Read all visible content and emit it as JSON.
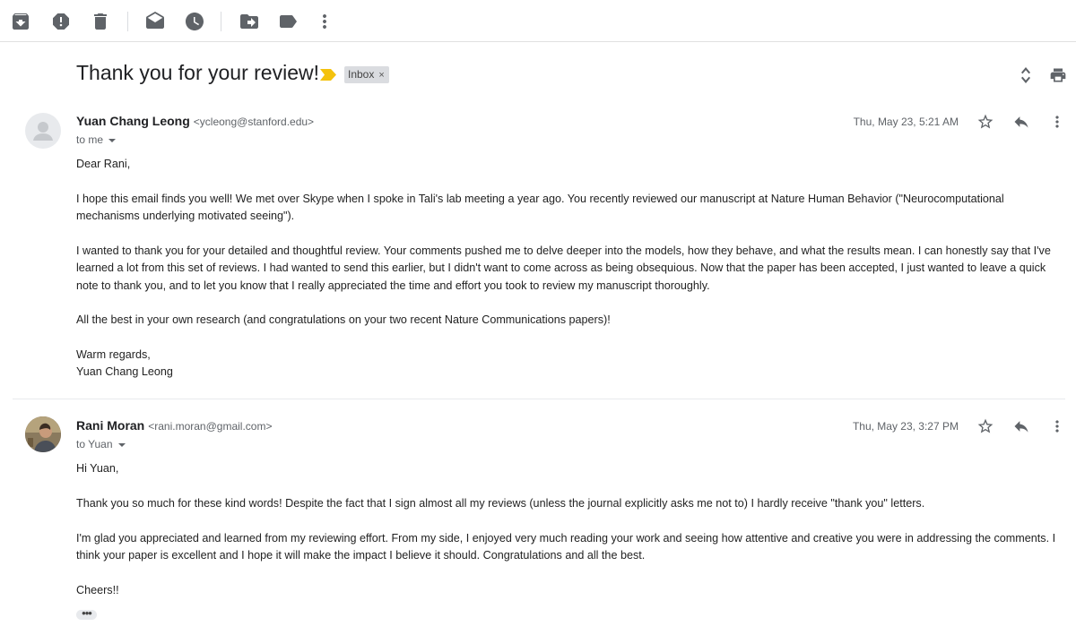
{
  "toolbar": {
    "icons": [
      "archive-icon",
      "report-spam-icon",
      "delete-icon",
      "mark-unread-icon",
      "snooze-icon",
      "move-to-icon",
      "label-icon",
      "more-vert-icon"
    ]
  },
  "thread": {
    "subject": "Thank you for your review!",
    "label": "Inbox",
    "label_close": "×",
    "colors": {
      "importance": "#f4c20d",
      "label_bg": "#dadce0"
    }
  },
  "messages": [
    {
      "sender_name": "Yuan Chang Leong",
      "sender_email": "<ycleong@stanford.edu>",
      "to": "to me",
      "date": "Thu, May 23, 5:21 AM",
      "paragraphs": [
        "Dear Rani,",
        "I hope this email finds you well! We met over Skype when I spoke in Tali's lab meeting a year ago. You recently reviewed our manuscript at Nature Human Behavior (\"Neurocomputational mechanisms underlying motivated seeing\").",
        "I wanted to thank you for your detailed and thoughtful review. Your comments pushed me to delve deeper into the models, how they behave, and what the results mean. I can honestly say that I've learned a lot from this set of reviews. I had wanted to send this earlier, but I didn't want to come across as being obsequious. Now that the paper has been accepted, I just wanted to leave a quick note to thank you, and to let you know that I really appreciated the time and effort you took to review my manuscript thoroughly.",
        "All the best in your own research (and congratulations on your two recent Nature Communications papers)!",
        "Warm regards,",
        "Yuan Chang Leong"
      ]
    },
    {
      "sender_name": "Rani Moran",
      "sender_email": "<rani.moran@gmail.com>",
      "to": "to Yuan",
      "date": "Thu, May 23, 3:27 PM",
      "paragraphs": [
        "Hi Yuan,",
        "Thank you so much for these kind words! Despite the fact that I sign almost all my reviews (unless the journal explicitly asks me not to) I hardly receive \"thank you\" letters.",
        "I'm glad you appreciated and learned from my reviewing effort. From my side, I enjoyed very much reading your work and seeing how attentive and creative you were in addressing the comments. I think your paper is excellent and I hope it will make the impact I believe it should. Congratulations and all the best.",
        "Cheers!!"
      ]
    }
  ]
}
